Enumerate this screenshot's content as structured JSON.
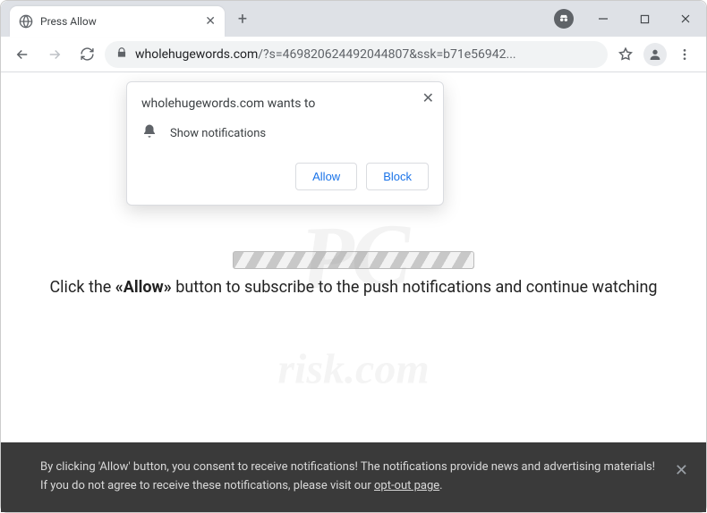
{
  "window": {
    "tab_title": "Press Allow",
    "url_domain": "wholehugewords.com",
    "url_path": "/?s=469820624492044807&ssk=b71e56942..."
  },
  "permission_dialog": {
    "headline": "wholehugewords.com wants to",
    "row": "Show notifications",
    "allow": "Allow",
    "block": "Block"
  },
  "page": {
    "msg_pre": "Click the ",
    "msg_bold": "«Allow»",
    "msg_post": " button to subscribe to the push notifications and continue watching"
  },
  "watermark": {
    "line1": "PC",
    "line2": "risk.com"
  },
  "cookie": {
    "text_a": "By clicking 'Allow' button, you consent to receive notifications! The notifications provide news and advertising materials! If you do not agree to receive these notifications, please visit our ",
    "link": "opt-out page",
    "text_b": "."
  }
}
